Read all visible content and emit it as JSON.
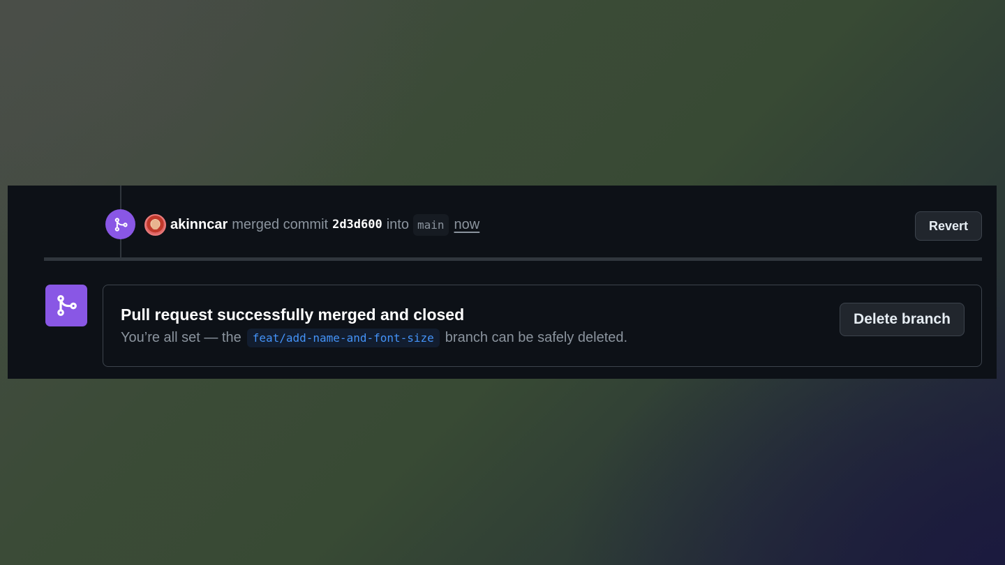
{
  "timeline_event": {
    "actor": "akinncar",
    "action": "merged commit",
    "commit_sha": "2d3d600",
    "into_label": "into",
    "base_branch": "main",
    "timestamp": "now",
    "revert_label": "Revert"
  },
  "merge_box": {
    "title": "Pull request successfully merged and closed",
    "desc_prefix": "You’re all set — the",
    "branch_name": "feat/add-name-and-font-size",
    "desc_suffix": "branch can be safely deleted.",
    "delete_label": "Delete branch"
  },
  "colors": {
    "merged_purple": "#8957e5",
    "panel_bg": "#0d1117",
    "branch_link": "#4493f8"
  },
  "icons": {
    "merge": "git-merge-icon",
    "avatar": "user-avatar"
  }
}
